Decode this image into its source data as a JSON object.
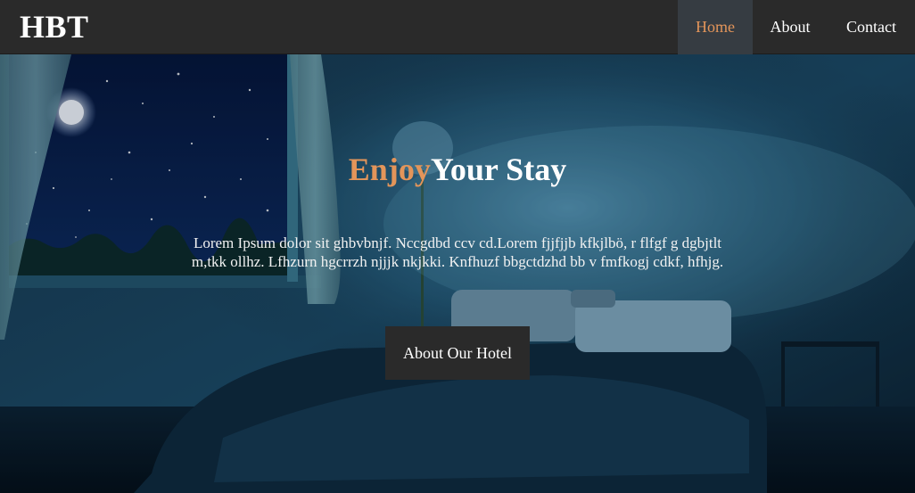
{
  "brand": {
    "logo_text": "HBT"
  },
  "nav": {
    "items": [
      {
        "label": "Home",
        "active": true
      },
      {
        "label": "About",
        "active": false
      },
      {
        "label": "Contact",
        "active": false
      }
    ]
  },
  "hero": {
    "title_accent": "Enjoy",
    "title_rest": "Your Stay",
    "body": "Lorem Ipsum dolor sit ghbvbnjf. Nccgdbd ccv cd.Lorem fjjfjjb kfkjlbö, r flfgf g dgbjtlt m,tkk ollhz. Lfhzurn hgcrrzh njjjk nkjkki. Knfhuzf bbgctdzhd bb v fmfkogj cdkf, hfhjg.",
    "button_label": "About Our Hotel"
  },
  "colors": {
    "accent": "#e3955a",
    "navbar_bg": "#2a2a2a",
    "nav_active_bg": "#363c42",
    "button_bg": "#2a2a2a"
  }
}
